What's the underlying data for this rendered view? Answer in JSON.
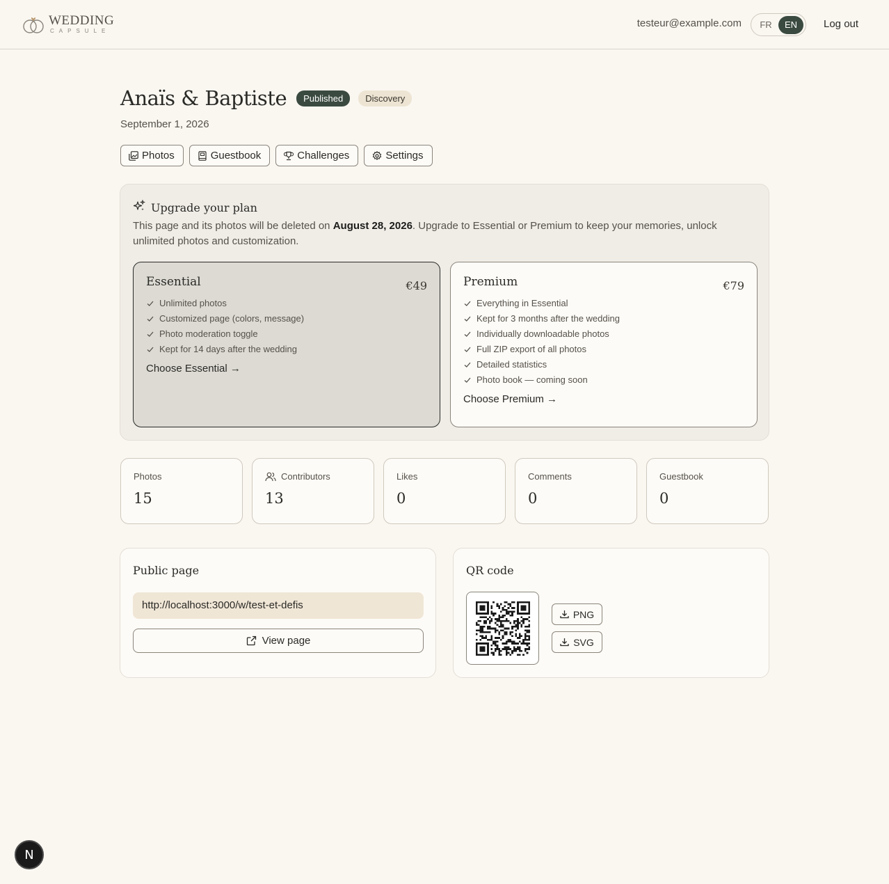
{
  "header": {
    "logo_word": "WEDDING",
    "logo_sub": "CAPSULE",
    "email": "testeur@example.com",
    "lang_fr": "FR",
    "lang_en": "EN",
    "logout": "Log out"
  },
  "event": {
    "title": "Anaïs & Baptiste",
    "status_badge": "Published",
    "plan_badge": "Discovery",
    "date": "September 1, 2026"
  },
  "tabs": [
    {
      "label": "Photos",
      "icon": "photos-icon"
    },
    {
      "label": "Guestbook",
      "icon": "book-icon"
    },
    {
      "label": "Challenges",
      "icon": "trophy-icon"
    },
    {
      "label": "Settings",
      "icon": "gear-icon"
    }
  ],
  "upgrade": {
    "title": "Upgrade your plan",
    "text_before": "This page and its photos will be deleted on ",
    "deadline": "August 28, 2026",
    "text_after": ". Upgrade to Essential or Premium to keep your memories, unlock unlimited photos and customization.",
    "plans": [
      {
        "name": "Essential",
        "price": "€49",
        "features": [
          "Unlimited photos",
          "Customized page (colors, message)",
          "Photo moderation toggle",
          "Kept for 14 days after the wedding"
        ],
        "cta": "Choose Essential →"
      },
      {
        "name": "Premium",
        "price": "€79",
        "features": [
          "Everything in Essential",
          "Kept for 3 months after the wedding",
          "Individually downloadable photos",
          "Full ZIP export of all photos",
          "Detailed statistics",
          "Photo book — coming soon"
        ],
        "cta": "Choose Premium →"
      }
    ]
  },
  "stats": [
    {
      "label": "Photos",
      "value": "15"
    },
    {
      "label": "Contributors",
      "value": "13"
    },
    {
      "label": "Likes",
      "value": "0"
    },
    {
      "label": "Comments",
      "value": "0"
    },
    {
      "label": "Guestbook",
      "value": "0"
    }
  ],
  "public_page": {
    "title": "Public page",
    "url": "http://localhost:3000/w/test-et-defis",
    "view_button": "View page"
  },
  "qr": {
    "title": "QR code",
    "png_button": "PNG",
    "svg_button": "SVG"
  },
  "dev_badge": "N",
  "colors": {
    "background": "#faf7f1",
    "accent_dark": "#3a4a40",
    "badge_beige": "#ede4d3",
    "url_bg": "#f0e6d6"
  }
}
